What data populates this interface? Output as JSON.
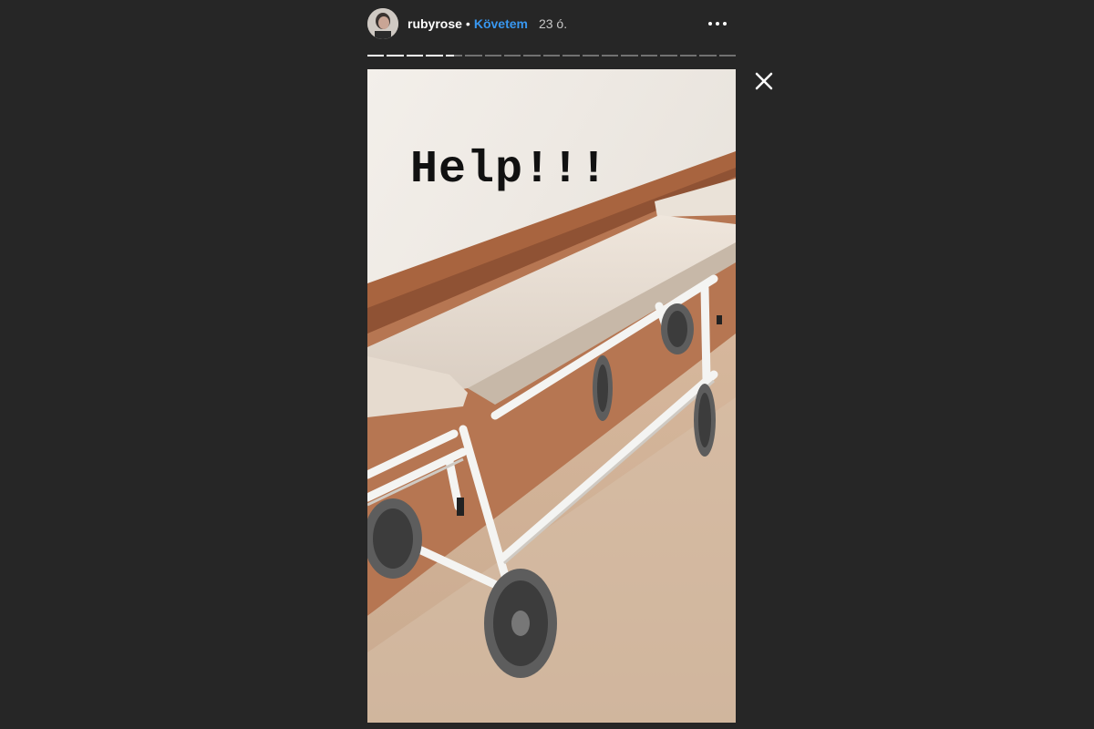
{
  "header": {
    "username": "rubyrose",
    "separator": "•",
    "follow_label": "Követem",
    "time": "23 ó.",
    "avatar_icon": "profile-avatar",
    "more_icon": "more-horizontal-icon"
  },
  "progress": {
    "total_segments": 19,
    "completed_segments": 4,
    "current_segment_progress": 0.5
  },
  "close_icon": "close-icon",
  "story": {
    "overlay_text": "Help!!!",
    "photo": "hospital-stretcher-photo"
  },
  "colors": {
    "background": "#262626",
    "follow": "#3897f0",
    "text": "#ffffff",
    "time": "#c7c7c7"
  }
}
